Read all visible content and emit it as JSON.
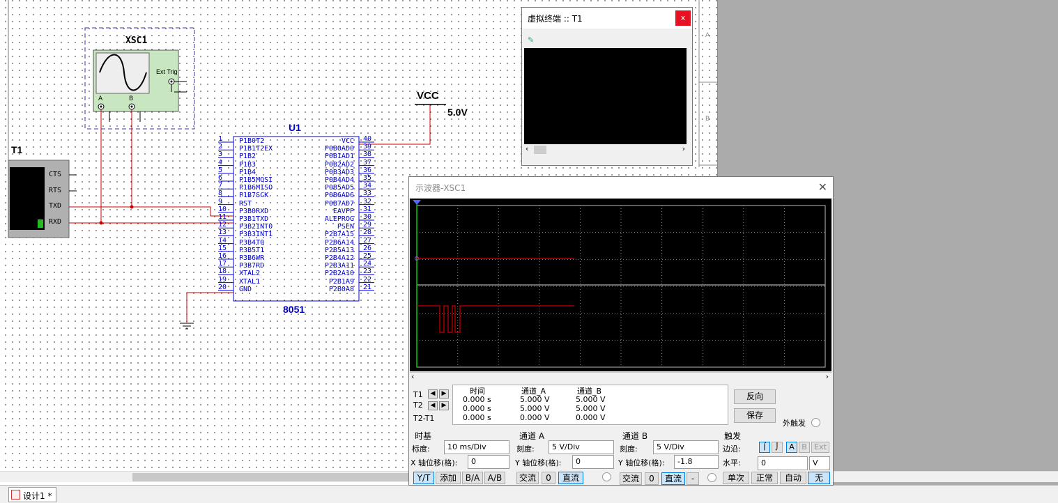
{
  "schematic": {
    "scope_ref": "XSC1",
    "scope_ext_trig": "Ext Trig",
    "scope_ch_a": "A",
    "scope_ch_b": "B",
    "terminal_ref": "T1",
    "terminal_pins": [
      "CTS",
      "RTS",
      "TXD",
      "RXD"
    ],
    "mcu_ref": "U1",
    "mcu_part": "8051",
    "vcc_label": "VCC",
    "vcc_value": "5.0V",
    "left_pins": [
      {
        "num": "1",
        "name": "P1B0T2"
      },
      {
        "num": "2",
        "name": "P1B1T2EX"
      },
      {
        "num": "3",
        "name": "P1B2"
      },
      {
        "num": "4",
        "name": "P1B3"
      },
      {
        "num": "5",
        "name": "P1B4"
      },
      {
        "num": "6",
        "name": "P1B5MOSI"
      },
      {
        "num": "7",
        "name": "P1B6MISO"
      },
      {
        "num": "8",
        "name": "P1B7SCK"
      },
      {
        "num": "9",
        "name": "RST"
      },
      {
        "num": "10",
        "name": "P3B0RXD"
      },
      {
        "num": "11",
        "name": "P3B1TXD"
      },
      {
        "num": "12",
        "name": "P3B2INT0"
      },
      {
        "num": "13",
        "name": "P3B3INT1"
      },
      {
        "num": "14",
        "name": "P3B4T0"
      },
      {
        "num": "15",
        "name": "P3B5T1"
      },
      {
        "num": "16",
        "name": "P3B6WR"
      },
      {
        "num": "17",
        "name": "P3B7RD"
      },
      {
        "num": "18",
        "name": "XTAL2"
      },
      {
        "num": "19",
        "name": "XTAL1"
      },
      {
        "num": "20",
        "name": "GND"
      }
    ],
    "right_pins": [
      {
        "num": "40",
        "name": "VCC"
      },
      {
        "num": "39",
        "name": "P0B0AD0"
      },
      {
        "num": "38",
        "name": "P0B1AD1"
      },
      {
        "num": "37",
        "name": "P0B2AD2"
      },
      {
        "num": "36",
        "name": "P0B3AD3"
      },
      {
        "num": "35",
        "name": "P0B4AD4"
      },
      {
        "num": "34",
        "name": "P0B5AD5"
      },
      {
        "num": "33",
        "name": "P0B6AD6"
      },
      {
        "num": "32",
        "name": "P0B7AD7"
      },
      {
        "num": "31",
        "name": "EAVPP"
      },
      {
        "num": "30",
        "name": "ALEPROG"
      },
      {
        "num": "29",
        "name": "PSEN"
      },
      {
        "num": "28",
        "name": "P2B7A15"
      },
      {
        "num": "27",
        "name": "P2B6A14"
      },
      {
        "num": "26",
        "name": "P2B5A13"
      },
      {
        "num": "25",
        "name": "P2B4A12"
      },
      {
        "num": "24",
        "name": "P2B3A11"
      },
      {
        "num": "23",
        "name": "P2B2A10"
      },
      {
        "num": "22",
        "name": "P2B1A9"
      },
      {
        "num": "21",
        "name": "P2B0A8"
      }
    ],
    "border_labels": [
      "A",
      "B"
    ]
  },
  "terminal_window": {
    "title": "虚拟终端 :: T1",
    "close": "x"
  },
  "scope_window": {
    "title": "示波器-XSC1",
    "close": "✕",
    "cursor_labels": [
      "T1",
      "T2",
      "T2-T1"
    ],
    "readout_headers": [
      "时间",
      "通道_A",
      "通道_B"
    ],
    "readout_rows": [
      [
        "0.000 s",
        "5.000 V",
        "5.000 V"
      ],
      [
        "0.000 s",
        "5.000 V",
        "5.000 V"
      ],
      [
        "0.000 s",
        "0.000 V",
        "0.000 V"
      ]
    ],
    "reverse_button": "反向",
    "save_button": "保存",
    "ext_trigger_label": "外触发",
    "timebase": {
      "heading": "时基",
      "scale_label": "标度:",
      "scale_value": "10 ms/Div",
      "xpos_label": "X 轴位移(格):",
      "xpos_value": "0",
      "buttons": [
        "Y/T",
        "添加",
        "B/A",
        "A/B"
      ]
    },
    "channel_a": {
      "heading": "通道 A",
      "scale_label": "刻度:",
      "scale_value": "5  V/Div",
      "ypos_label": "Y 轴位移(格):",
      "ypos_value": "0",
      "buttons": [
        "交流",
        "0",
        "直流"
      ]
    },
    "channel_b": {
      "heading": "通道 B",
      "scale_label": "刻度:",
      "scale_value": "5  V/Div",
      "ypos_label": "Y 轴位移(格):",
      "ypos_value": "-1.8",
      "buttons": [
        "交流",
        "0",
        "直流",
        "-"
      ]
    },
    "trigger": {
      "heading": "触发",
      "edge_label": "边沿:",
      "level_label": "水平:",
      "level_value": "0",
      "level_unit": "V",
      "source_buttons": [
        "A",
        "B",
        "Ext"
      ],
      "mode_buttons": [
        "单次",
        "正常",
        "自动",
        "无"
      ]
    }
  },
  "tabs": [
    {
      "label": "设计1 *"
    }
  ],
  "colors": {
    "wire": "#cc0000",
    "pin_text": "#0000cc",
    "trace_a": "#cc0000",
    "trace_b": "#cc0000",
    "cursor1": "#00cc00",
    "selected_btn": "#cce4f7"
  }
}
